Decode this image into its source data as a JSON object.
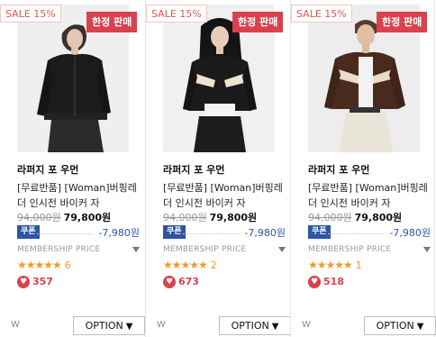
{
  "products": [
    {
      "sale_badge": "SALE 15%",
      "limited_badge": "한정 판매",
      "brand": "라퍼지 포 우먼",
      "name": "[무료반품] [Woman]버핑레더 인시전 바이커 자",
      "original_price": "94,000원",
      "sale_price": "79,800원",
      "coupon_label": "쿠폰",
      "coupon_amount": "-7,980원",
      "membership_label": "MEMBERSHIP PRICE",
      "stars": "★★★★★",
      "review_count": "6",
      "likes": "357",
      "w_label": "W",
      "option_label": "OPTION"
    },
    {
      "sale_badge": "SALE 15%",
      "limited_badge": "한정 판매",
      "brand": "라퍼지 포 우먼",
      "name": "[무료반품] [Woman]버핑레더 인시전 바이커 자",
      "original_price": "94,000원",
      "sale_price": "79,800원",
      "coupon_label": "쿠폰",
      "coupon_amount": "-7,980원",
      "membership_label": "MEMBERSHIP PRICE",
      "stars": "★★★★★",
      "review_count": "2",
      "likes": "673",
      "w_label": "W",
      "option_label": "OPTION"
    },
    {
      "sale_badge": "SALE 15%",
      "limited_badge": "한정 판매",
      "brand": "라퍼지 포 우먼",
      "name": "[무료반품] [Woman]버핑레더 인시전 바이커 자",
      "original_price": "94,000원",
      "sale_price": "79,800원",
      "coupon_label": "쿠폰",
      "coupon_amount": "-7,980원",
      "membership_label": "MEMBERSHIP PRICE",
      "stars": "★★★★★",
      "review_count": "1",
      "likes": "518",
      "w_label": "W",
      "option_label": "OPTION"
    }
  ],
  "colors": {
    "sale_text": "#e0584e",
    "limited_bg": "#d9414e",
    "coupon": "#2c55a5",
    "star": "#f49a2d",
    "heart": "#d9414e"
  },
  "icons": {
    "heart": "heart-icon",
    "caret": "caret-down-icon",
    "star": "star-icon"
  }
}
